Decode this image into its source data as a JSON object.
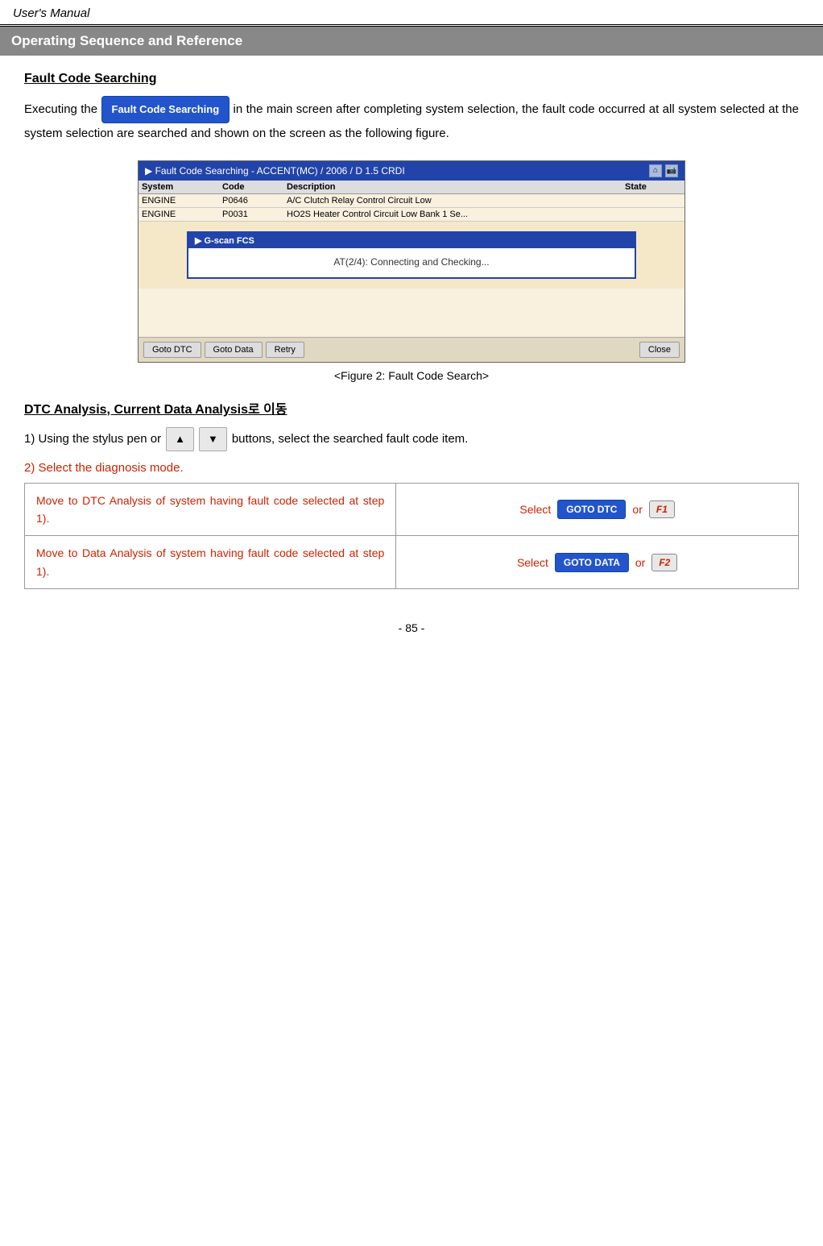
{
  "header": {
    "title": "User's Manual"
  },
  "section": {
    "title": "Operating Sequence and Reference"
  },
  "fault_code": {
    "heading": "Fault Code Searching",
    "button_label": "Fault Code Searching",
    "intro": "Executing the",
    "intro_after": "in the main screen after completing system selection, the fault code occurred at all system selected at the system selection are searched and shown on the screen as the following figure."
  },
  "screenshot": {
    "titlebar": "▶ Fault Code Searching - ACCENT(MC) / 2006 / D 1.5 CRDI",
    "columns": [
      "System",
      "Code",
      "Description",
      "State"
    ],
    "rows": [
      [
        "ENGINE",
        "P0646",
        "A/C Clutch Relay Control Circuit Low",
        ""
      ],
      [
        "ENGINE",
        "P0031",
        "HO2S Heater Control Circuit Low Bank 1  Se...",
        ""
      ]
    ],
    "dialog_title": "▶ G-scan FCS",
    "dialog_body": "AT(2/4): Connecting and Checking...",
    "buttons": [
      "Goto DTC",
      "Goto Data",
      "Retry",
      "",
      "Close"
    ]
  },
  "figure_caption": "<Figure 2: Fault Code Search>",
  "dtc_section": {
    "title": "DTC Analysis, Current Data Analysis로  이동",
    "step1_prefix": "1)  Using the stylus pen or",
    "step1_suffix": "buttons, select the searched fault code item.",
    "step2": "2) Select the diagnosis mode."
  },
  "table": {
    "rows": [
      {
        "left": "Move  to  DTC  Analysis  of  system having fault code selected at step 1).",
        "select_label": "Select",
        "goto_label": "GOTO DTC",
        "or_label": "or",
        "f_label": "F1"
      },
      {
        "left": "Move  to  Data  Analysis  of  system having fault code selected at step 1).",
        "select_label": "Select",
        "goto_label": "GOTO DATA",
        "or_label": "or",
        "f_label": "F2"
      }
    ]
  },
  "footer": {
    "page_label": "- 85 -"
  },
  "icons": {
    "up_arrow": "▲",
    "down_arrow": "▼",
    "home_icon": "⌂",
    "camera_icon": "📷"
  }
}
